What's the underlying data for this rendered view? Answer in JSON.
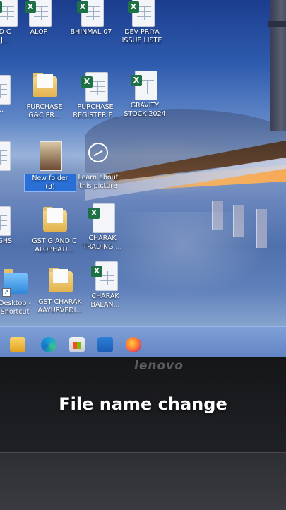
{
  "desktop": {
    "icons": [
      {
        "label": "D C\nJ...",
        "type": "excel"
      },
      {
        "label": "ALOP",
        "type": "excel"
      },
      {
        "label": "BHINMAL 07",
        "type": "excel"
      },
      {
        "label": "DEV PRIYA\nISSUE LISTE",
        "type": "excel"
      },
      {
        "label": "D...",
        "type": "excel"
      },
      {
        "label": "PURCHASE\nG&C PR...",
        "type": "folder"
      },
      {
        "label": "PURCHASE\nREGISTER F...",
        "type": "excel"
      },
      {
        "label": "GRAVITY\nSTOCK 2024",
        "type": "excel"
      },
      {
        "label": "",
        "type": "excel"
      },
      {
        "label": "New folder\n(3)",
        "type": "photo",
        "selected": true
      },
      {
        "label": "Learn about\nthis picture",
        "type": "spotlight"
      },
      {
        "label": "LY RGHS",
        "type": "excel"
      },
      {
        "label": "GST G AND C\nALOPHATI...",
        "type": "folder"
      },
      {
        "label": "CHARAK\nTRADING ...",
        "type": "excel"
      },
      {
        "label": "Desktop -\nShortcut",
        "type": "shortcut"
      },
      {
        "label": "GST CHARAK\nAAYURVEDI...",
        "type": "folder"
      },
      {
        "label": "CHARAK\nBALAN...",
        "type": "excel"
      }
    ]
  },
  "taskbar": {
    "apps": [
      "file-explorer-icon",
      "edge-icon",
      "store-icon",
      "mail-icon",
      "firefox-icon"
    ]
  },
  "bezel": {
    "brand": "lenovo"
  },
  "caption": "File name change"
}
